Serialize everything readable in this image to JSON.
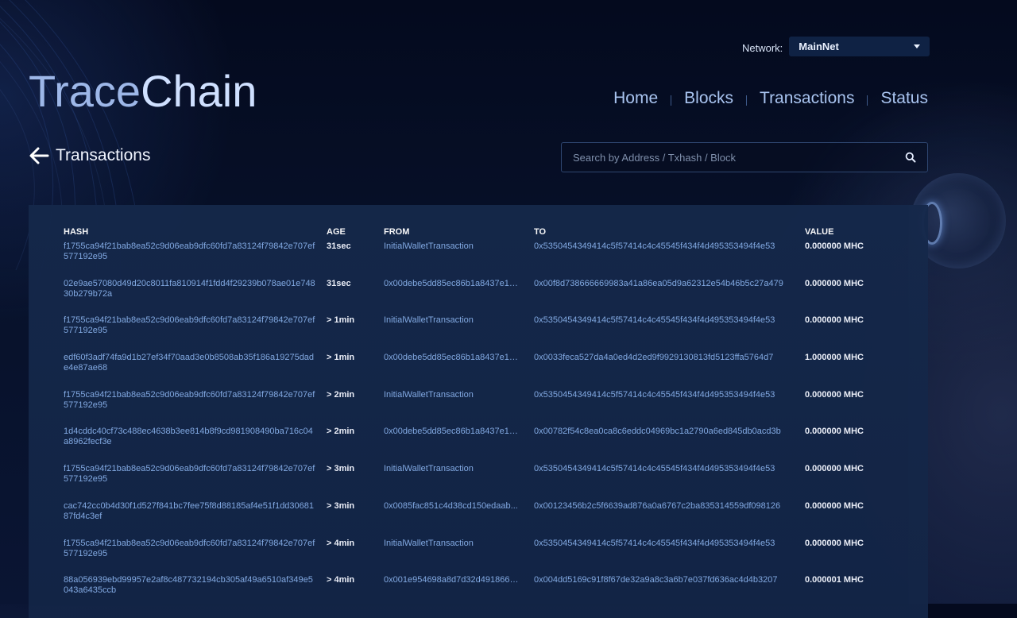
{
  "brand": {
    "part1": "Trace",
    "part2": "Chain"
  },
  "network": {
    "label": "Network:",
    "selected": "MainNet"
  },
  "nav": {
    "items": [
      "Home",
      "Blocks",
      "Transactions",
      "Status"
    ]
  },
  "page": {
    "title": "Transactions"
  },
  "search": {
    "placeholder": "Search by Address / Txhash / Block"
  },
  "table": {
    "headers": {
      "hash": "HASH",
      "age": "AGE",
      "from": "FROM",
      "to": "TO",
      "value": "VALUE"
    },
    "rows": [
      {
        "hash": "f1755ca94f21bab8ea52c9d06eab9dfc60fd7a83124f79842e707ef577192e95",
        "age": "31sec",
        "from": "InitialWalletTransaction",
        "to": "0x5350454349414c5f57414c4c45545f434f4d495353494f4e53",
        "value": "0.000000 MHC"
      },
      {
        "hash": "02e9ae57080d49d20c8011fa810914f1fdd4f29239b078ae01e74830b279b72a",
        "age": "31sec",
        "from": "0x00debe5dd85ec86b1a8437e1d...",
        "to": "0x00f8d738666669983a41a86ea05d9a62312e54b46b5c27a479",
        "value": "0.000000 MHC"
      },
      {
        "hash": "f1755ca94f21bab8ea52c9d06eab9dfc60fd7a83124f79842e707ef577192e95",
        "age": "> 1min",
        "from": "InitialWalletTransaction",
        "to": "0x5350454349414c5f57414c4c45545f434f4d495353494f4e53",
        "value": "0.000000 MHC"
      },
      {
        "hash": "edf60f3adf74fa9d1b27ef34f70aad3e0b8508ab35f186a19275dade4e87ae68",
        "age": "> 1min",
        "from": "0x00debe5dd85ec86b1a8437e1d...",
        "to": "0x0033feca527da4a0ed4d2ed9f9929130813fd5123ffa5764d7",
        "value": "1.000000 MHC"
      },
      {
        "hash": "f1755ca94f21bab8ea52c9d06eab9dfc60fd7a83124f79842e707ef577192e95",
        "age": "> 2min",
        "from": "InitialWalletTransaction",
        "to": "0x5350454349414c5f57414c4c45545f434f4d495353494f4e53",
        "value": "0.000000 MHC"
      },
      {
        "hash": "1d4cddc40cf73c488ec4638b3ee814b8f9cd981908490ba716c04a8962fecf3e",
        "age": "> 2min",
        "from": "0x00debe5dd85ec86b1a8437e1d...",
        "to": "0x00782f54c8ea0ca8c6eddc04969bc1a2790a6ed845db0acd3b",
        "value": "0.000000 MHC"
      },
      {
        "hash": "f1755ca94f21bab8ea52c9d06eab9dfc60fd7a83124f79842e707ef577192e95",
        "age": "> 3min",
        "from": "InitialWalletTransaction",
        "to": "0x5350454349414c5f57414c4c45545f434f4d495353494f4e53",
        "value": "0.000000 MHC"
      },
      {
        "hash": "cac742cc0b4d30f1d527f841bc7fee75f8d88185af4e51f1dd3068187fd4c3ef",
        "age": "> 3min",
        "from": "0x0085fac851c4d38cd150edaab...",
        "to": "0x00123456b2c5f6639ad876a0a6767c2ba835314559df098126",
        "value": "0.000000 MHC"
      },
      {
        "hash": "f1755ca94f21bab8ea52c9d06eab9dfc60fd7a83124f79842e707ef577192e95",
        "age": "> 4min",
        "from": "InitialWalletTransaction",
        "to": "0x5350454349414c5f57414c4c45545f434f4d495353494f4e53",
        "value": "0.000000 MHC"
      },
      {
        "hash": "88a056939ebd99957e2af8c487732194cb305af49a6510af349e5043a6435ccb",
        "age": "> 4min",
        "from": "0x001e954698a8d7d32d491866c...",
        "to": "0x004dd5169c91f8f67de32a9a8c3a6b7e037fd636ac4d4b3207",
        "value": "0.000001 MHC"
      }
    ]
  }
}
